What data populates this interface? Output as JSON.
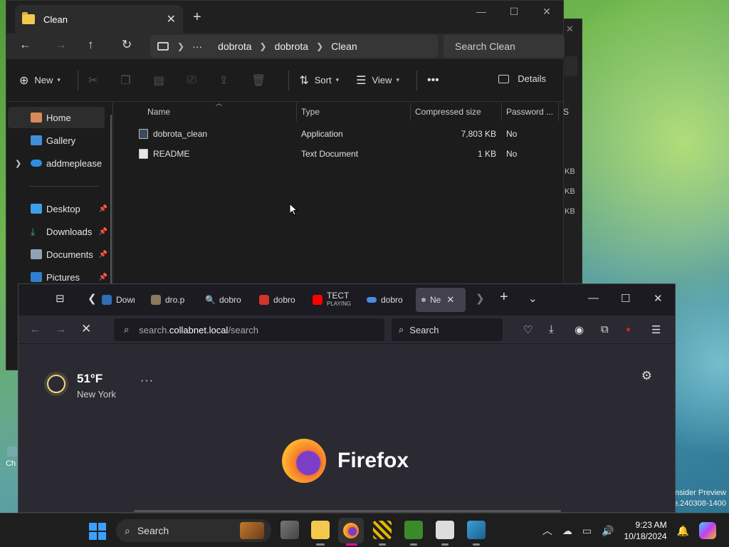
{
  "desktop": {
    "watermark_line1": "nsider Preview",
    "watermark_line2": "e.240308-1400",
    "desktop_icon_label": "Ch"
  },
  "explorer": {
    "tab_title": "Clean",
    "breadcrumb": [
      "dobrota",
      "dobrota",
      "Clean"
    ],
    "search_placeholder": "Search Clean",
    "commands": {
      "new": "New",
      "sort": "Sort",
      "view": "View",
      "details": "Details"
    },
    "sidebar": [
      {
        "label": "Home",
        "icon": "home-icon",
        "selected": true
      },
      {
        "label": "Gallery",
        "icon": "gallery-icon"
      },
      {
        "label": "addmeplease - P",
        "icon": "onedrive-icon",
        "expandable": true
      },
      {
        "label": "Desktop",
        "icon": "desktop-icon",
        "pinned": true
      },
      {
        "label": "Downloads",
        "icon": "download-icon",
        "pinned": true
      },
      {
        "label": "Documents",
        "icon": "documents-icon",
        "pinned": true
      },
      {
        "label": "Pictures",
        "icon": "pictures-icon",
        "pinned": true
      }
    ],
    "columns": [
      "Name",
      "Type",
      "Compressed size",
      "Password ...",
      "Si"
    ],
    "files": [
      {
        "name": "dobrota_clean",
        "type": "Application",
        "size": "7,803 KB",
        "password": "No",
        "icon": "application-icon"
      },
      {
        "name": "README",
        "type": "Text Document",
        "size": "1 KB",
        "password": "No",
        "icon": "text-document-icon"
      }
    ],
    "back_window_kb": [
      "KB",
      "KB",
      "KB"
    ]
  },
  "firefox": {
    "tabs": [
      {
        "label": "Down",
        "color": "#2f6fb3"
      },
      {
        "label": "dro.p",
        "color": "#8a7a5a"
      },
      {
        "label": "dobro",
        "color": "#d77b2a"
      },
      {
        "label": "dobro",
        "color": "#d0342c"
      },
      {
        "label": "TECT",
        "sub": "PLAYING",
        "color": "#ff0000"
      },
      {
        "label": "dobro",
        "color": "#4a8de0"
      },
      {
        "label": "Ne",
        "color": "#aaaaaa",
        "active": true
      }
    ],
    "url_prefix": "search.",
    "url_host": "collabnet.local",
    "url_path": "/search",
    "search_placeholder": "Search",
    "weather": {
      "temp": "51°F",
      "city": "New York"
    },
    "brand": "Firefox"
  },
  "taskbar": {
    "search_placeholder": "Search",
    "time": "9:23 AM",
    "date": "10/18/2024"
  }
}
